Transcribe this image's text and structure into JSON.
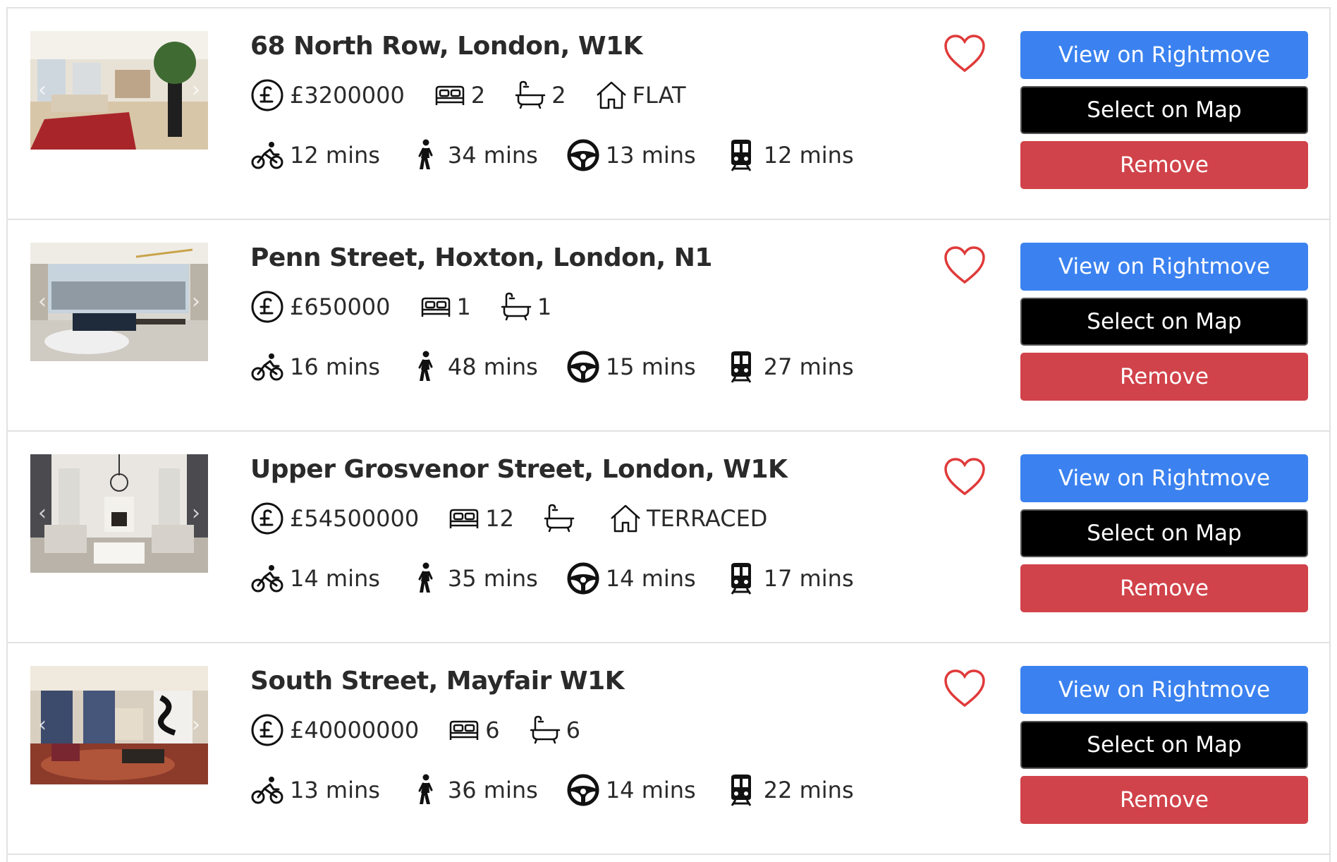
{
  "listings": [
    {
      "title": "68 North Row, London, W1K",
      "price": "£3200000",
      "beds": "2",
      "baths": "2",
      "type": "FLAT",
      "bike": "12 mins",
      "walk": "34 mins",
      "drive": "13 mins",
      "transit": "12 mins",
      "photo_theme": "living-red-rug"
    },
    {
      "title": "Penn Street, Hoxton, London, N1",
      "price": "£650000",
      "beds": "1",
      "baths": "1",
      "type": "",
      "bike": "16 mins",
      "walk": "48 mins",
      "drive": "15 mins",
      "transit": "27 mins",
      "photo_theme": "city-view-lounge"
    },
    {
      "title": "Upper Grosvenor Street, London, W1K",
      "price": "£54500000",
      "beds": "12",
      "baths": "",
      "type": "TERRACED",
      "bike": "14 mins",
      "walk": "35 mins",
      "drive": "14 mins",
      "transit": "17 mins",
      "photo_theme": "grand-drawing-room"
    },
    {
      "title": "South Street, Mayfair W1K",
      "price": "£40000000",
      "beds": "6",
      "baths": "6",
      "type": "",
      "bike": "13 mins",
      "walk": "36 mins",
      "drive": "14 mins",
      "transit": "22 mins",
      "photo_theme": "ornate-salon"
    }
  ],
  "buttons": {
    "view": "View on Rightmove",
    "map": "Select on Map",
    "remove": "Remove"
  },
  "carousel": {
    "prev": "‹",
    "next": "›"
  },
  "icons": {
    "price": "pound-circle-icon",
    "beds": "bed-icon",
    "baths": "bathtub-icon",
    "type": "house-icon",
    "bike": "bicycle-icon",
    "walk": "walking-icon",
    "drive": "steering-wheel-icon",
    "transit": "train-icon",
    "favourite": "heart-icon"
  },
  "colors": {
    "view_button": "#3b82f0",
    "map_button": "#000000",
    "remove_button": "#d1434a",
    "heart": "#e03a3a"
  }
}
